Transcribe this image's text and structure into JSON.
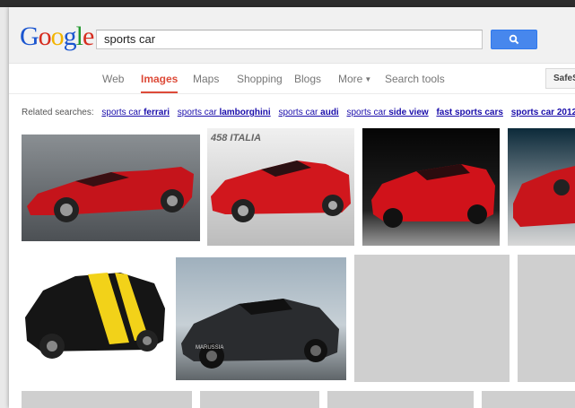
{
  "logo": {
    "text": "Google",
    "colors": [
      "#1a55cf",
      "#d62d20",
      "#f2b400",
      "#1a55cf",
      "#22992e",
      "#d62d20"
    ]
  },
  "search": {
    "query": "sports car",
    "button_icon": "search-icon"
  },
  "tabs": [
    {
      "label": "Web",
      "active": false
    },
    {
      "label": "Images",
      "active": true
    },
    {
      "label": "Maps",
      "active": false
    },
    {
      "label": "Shopping",
      "active": false
    },
    {
      "label": "Blogs",
      "active": false
    },
    {
      "label": "More",
      "active": false
    },
    {
      "label": "Search tools",
      "active": false
    }
  ],
  "safe_search_label": "SafeS",
  "related": {
    "label": "Related searches:",
    "items": [
      {
        "plain": "sports car ",
        "bold": "ferrari"
      },
      {
        "plain": "sports car ",
        "bold": "lamborghini"
      },
      {
        "plain": "sports car ",
        "bold": "audi"
      },
      {
        "plain": "sports car ",
        "bold": "side view"
      },
      {
        "plain": "",
        "bold": "fast sports cars"
      },
      {
        "plain": "",
        "bold": "sports car 2012"
      }
    ]
  },
  "images": [
    {
      "caption": "red concept sports car",
      "badge": ""
    },
    {
      "caption": "red Ferrari 458 Italia",
      "badge": "458 ITALIA"
    },
    {
      "caption": "red sports car on black background",
      "badge": ""
    },
    {
      "caption": "red Ferrari partial",
      "badge": ""
    },
    {
      "caption": "black and yellow striped roadster",
      "badge": ""
    },
    {
      "caption": "black Marussia sports car",
      "badge": "MARUSSIA"
    }
  ],
  "colors": {
    "accent_red": "#dd4b39",
    "link_blue": "#1a0dab",
    "button_blue": "#4787ed"
  }
}
